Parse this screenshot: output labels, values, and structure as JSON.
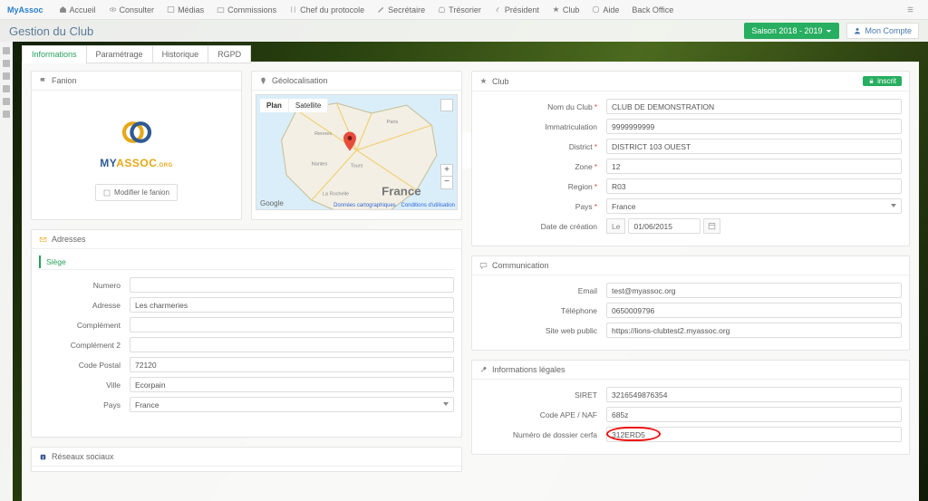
{
  "brand": "MyAssoc",
  "nav": {
    "accueil": "Accueil",
    "consulter": "Consulter",
    "medias": "Médias",
    "commissions": "Commissions",
    "chef": "Chef du protocole",
    "secretaire": "Secrétaire",
    "tresorier": "Trésorier",
    "president": "Président",
    "club": "Club",
    "aide": "Aide",
    "back": "Back Office"
  },
  "page_title": "Gestion du Club",
  "season_label": "Saison 2018 - 2019",
  "account_label": "Mon Compte",
  "tabs": {
    "informations": "Informations",
    "parametrage": "Paramétrage",
    "historique": "Historique",
    "rgpd": "RGPD"
  },
  "fanion": {
    "title": "Fanion",
    "logo_word_a": "MY",
    "logo_word_b": "ASSOC",
    "logo_suffix": ".ORG",
    "modify": "Modifier le fanion"
  },
  "geo": {
    "title": "Géolocalisation",
    "plan": "Plan",
    "satellite": "Satellite",
    "google": "Google",
    "carto": "Données cartographiques",
    "conditions": "Conditions d'utilisation",
    "france": "France"
  },
  "adresses": {
    "title": "Adresses",
    "subtab": "Siège",
    "numero_l": "Numero",
    "adresse_l": "Adresse",
    "adresse_v": "Les charmeries",
    "comp_l": "Complément",
    "comp2_l": "Complément 2",
    "cp_l": "Code Postal",
    "cp_v": "72120",
    "ville_l": "Ville",
    "ville_v": "Ecorpain",
    "pays_l": "Pays",
    "pays_v": "France"
  },
  "reseaux": {
    "title": "Réseaux sociaux"
  },
  "club": {
    "title": "Club",
    "badge": "inscrit",
    "nom_l": "Nom du Club",
    "nom_v": "CLUB DE DEMONSTRATION",
    "immat_l": "Immatriculation",
    "immat_v": "9999999999",
    "district_l": "District",
    "district_v": "DISTRICT 103 OUEST",
    "zone_l": "Zone",
    "zone_v": "12",
    "region_l": "Region",
    "region_v": "R03",
    "pays_l": "Pays",
    "pays_v": "France",
    "datec_l": "Date de création",
    "datec_pre": "Le",
    "datec_v": "01/06/2015"
  },
  "comm": {
    "title": "Communication",
    "email_l": "Email",
    "email_v": "test@myassoc.org",
    "tel_l": "Téléphone",
    "tel_v": "0650009796",
    "site_l": "Site web public",
    "site_v": "https://lions-clubtest2.myassoc.org"
  },
  "legal": {
    "title": "Informations légales",
    "siret_l": "SIRET",
    "siret_v": "3216549876354",
    "ape_l": "Code APE / NAF",
    "ape_v": "685z",
    "cerfa_l": "Numéro de dossier cerfa",
    "cerfa_v": "312ERD5"
  }
}
